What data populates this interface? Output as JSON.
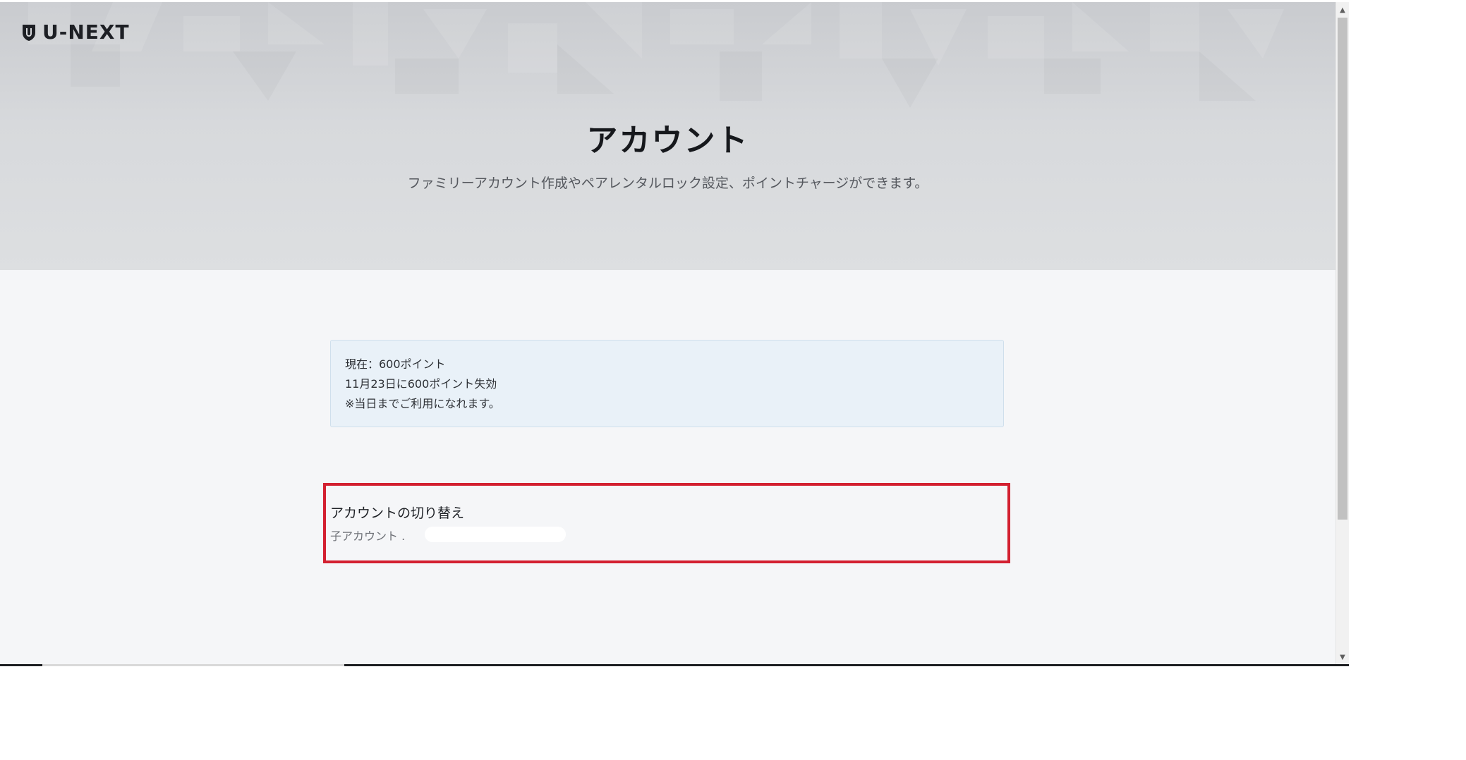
{
  "brand": {
    "logo_text": "U-NEXT",
    "logo_icon": "shield-icon"
  },
  "header": {
    "title": "アカウント",
    "subtitle": "ファミリーアカウント作成やペアレンタルロック設定、ポイントチャージができます。"
  },
  "points": {
    "current": "現在：600ポイント",
    "expiry": "11月23日に600ポイント失効",
    "note": "※当日までご利用になれます。"
  },
  "account_switch": {
    "title": "アカウントの切り替え",
    "sub_label": "子アカウント ."
  },
  "colors": {
    "highlight_border": "#d32030",
    "info_box_bg": "#e9f1f8",
    "page_bg": "#f5f6f8"
  }
}
